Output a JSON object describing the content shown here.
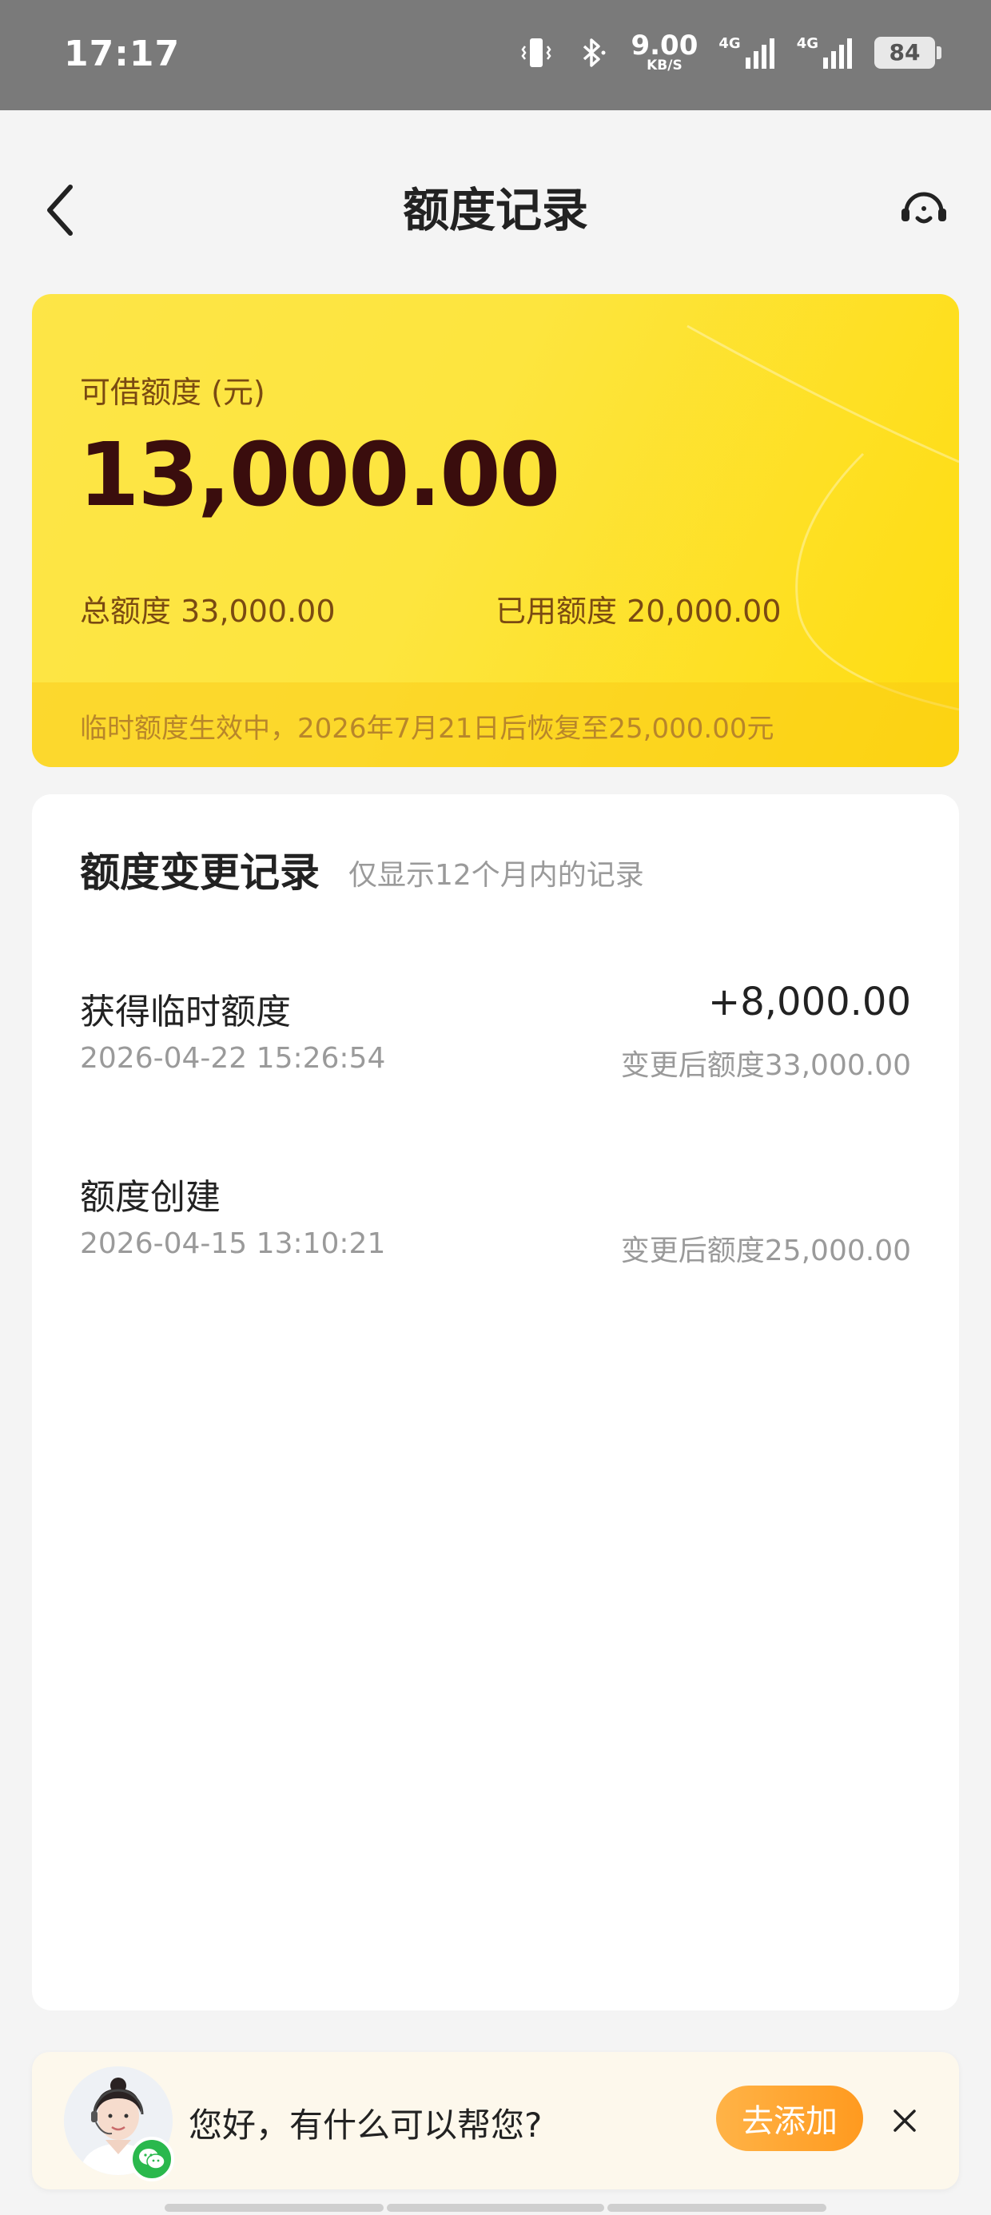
{
  "status_bar": {
    "time": "17:17",
    "net_speed_value": "9.00",
    "net_speed_unit": "KB/S",
    "network_1": "4G",
    "network_2": "4G",
    "battery": "84",
    "icons": [
      "vibrate-icon",
      "bluetooth-icon",
      "signal-icon",
      "signal-icon",
      "battery-icon"
    ]
  },
  "header": {
    "title": "额度记录",
    "back_icon": "chevron-left-icon",
    "service_icon": "headset-icon"
  },
  "quota_card": {
    "available_label": "可借额度 (元)",
    "available_amount": "13,000.00",
    "total_label": "总额度",
    "total_value": "33,000.00",
    "used_label": "已用额度",
    "used_value": "20,000.00",
    "temp_notice": "临时额度生效中，2026年7月21日后恢复至25,000.00元",
    "colors": {
      "gradient_start": "#fde547",
      "gradient_end": "#fedc10",
      "amount_text": "#3a0d0d"
    }
  },
  "records": {
    "title": "额度变更记录",
    "note": "仅显示12个月内的记录",
    "items": [
      {
        "name": "获得临时额度",
        "change": "+8,000.00",
        "time": "2026-04-22 15:26:54",
        "after": "变更后额度33,000.00"
      },
      {
        "name": "额度创建",
        "change": "",
        "time": "2026-04-15 13:10:21",
        "after": "变更后额度25,000.00"
      }
    ]
  },
  "chat_bar": {
    "greeting": "您好，有什么可以帮您?",
    "add_label": "去添加",
    "close_icon": "close-icon",
    "badge_icon": "wechat-icon",
    "accent": "#ff9a1f"
  }
}
